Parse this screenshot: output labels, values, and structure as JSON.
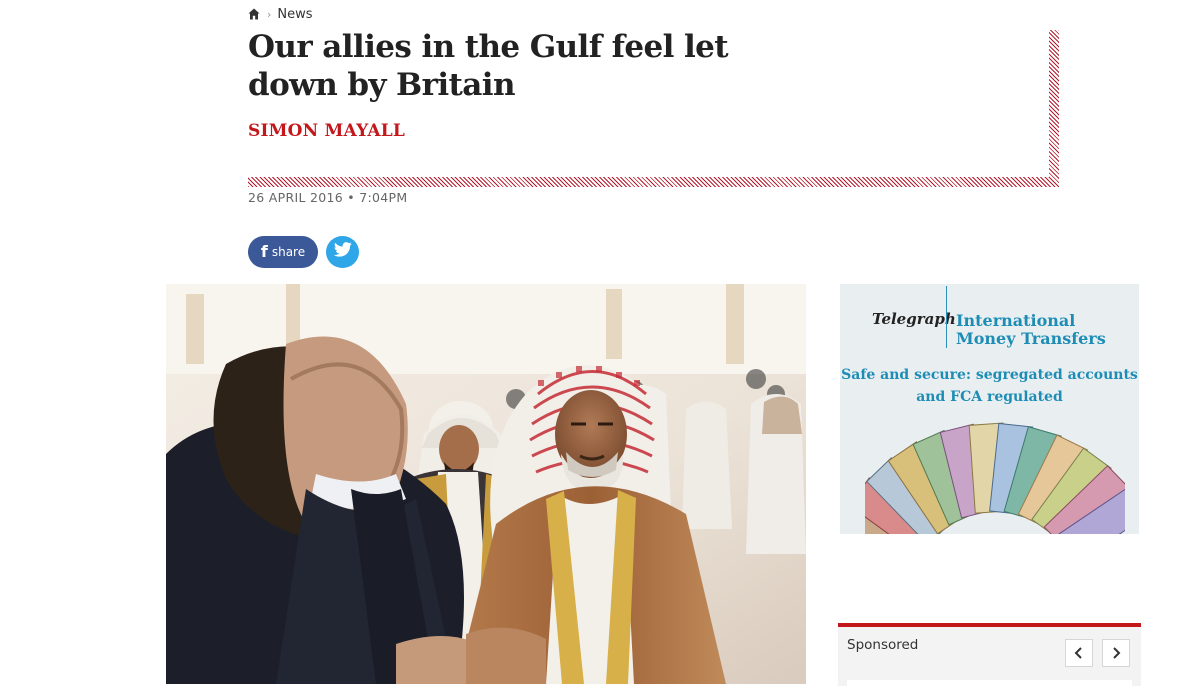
{
  "breadcrumb": {
    "home_icon": "home-icon",
    "section": "News"
  },
  "article": {
    "headline": "Our allies in the Gulf feel let down by Britain",
    "author": "SIMON MAYALL",
    "dateline": "26 APRIL 2016 • 7:04PM"
  },
  "share": {
    "facebook_label": "share",
    "facebook_icon": "facebook-icon",
    "twitter_icon": "twitter-icon"
  },
  "colors": {
    "accent_red": "#c4171c",
    "facebook_blue": "#3b5998",
    "twitter_blue": "#2ea6e8",
    "ad_blue": "#1d8db5"
  },
  "advert": {
    "brand": "Telegraph",
    "product": "International Money Transfers",
    "tagline": "Safe and secure: segregated accounts and FCA regulated"
  },
  "sponsored": {
    "label": "Sponsored",
    "prev_icon": "chevron-left-icon",
    "next_icon": "chevron-right-icon"
  }
}
